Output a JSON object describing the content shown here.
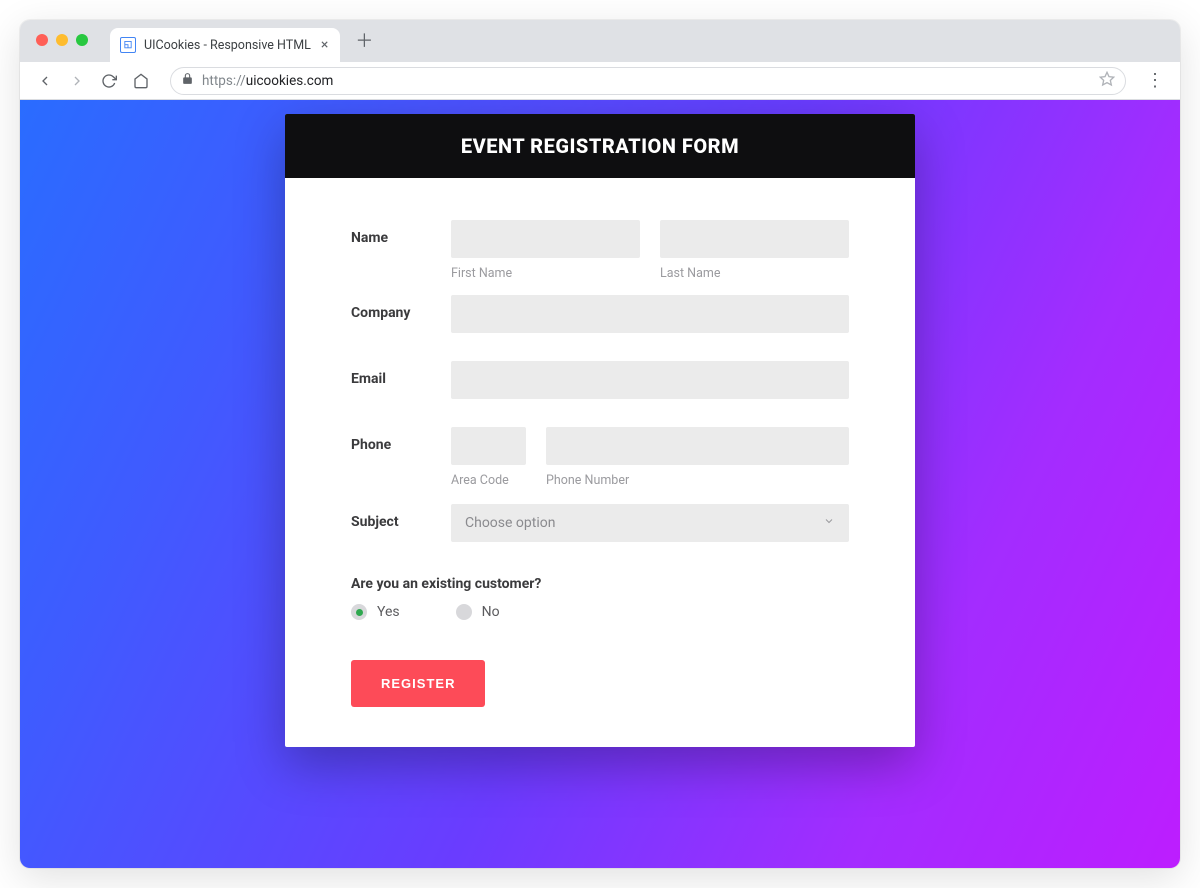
{
  "browser": {
    "tab_title": "UICookies - Responsive HTML",
    "url_scheme": "https://",
    "url_host": "uicookies.com"
  },
  "form": {
    "header": "EVENT REGISTRATION FORM",
    "labels": {
      "name": "Name",
      "company": "Company",
      "email": "Email",
      "phone": "Phone",
      "subject": "Subject"
    },
    "sublabels": {
      "first_name": "First Name",
      "last_name": "Last Name",
      "area_code": "Area Code",
      "phone_number": "Phone Number"
    },
    "subject_placeholder": "Choose option",
    "question": "Are you an existing customer?",
    "option_yes": "Yes",
    "option_no": "No",
    "submit": "REGISTER"
  }
}
